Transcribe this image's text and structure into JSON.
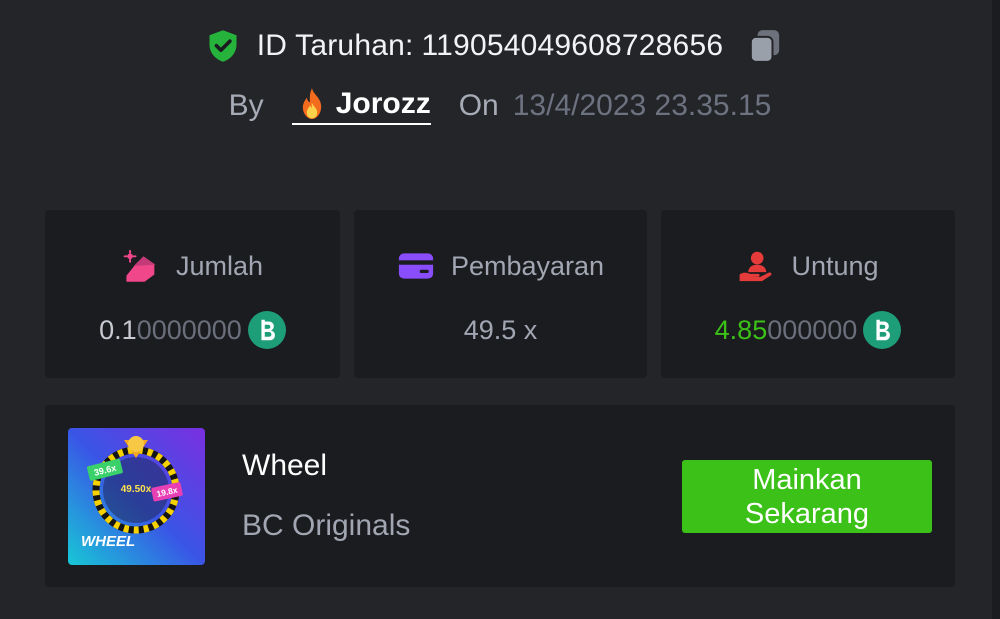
{
  "header": {
    "bet_id_label": "ID Taruhan:",
    "bet_id_value": "119054049608728656",
    "by_label": "By",
    "username": "Jorozz",
    "on_label": "On",
    "datetime": "13/4/2023 23.35.15"
  },
  "stats": {
    "amount": {
      "label": "Jumlah",
      "value_bright": "0.1",
      "value_dim": "0000000",
      "icon": "coins-hand-icon",
      "currency_icon": "bc-coin-icon"
    },
    "payout": {
      "label": "Pembayaran",
      "value": "49.5 x",
      "icon": "card-icon"
    },
    "profit": {
      "label": "Untung",
      "value_bright": "4.85",
      "value_dim": "000000",
      "icon": "hand-user-icon",
      "currency_icon": "bc-coin-icon"
    }
  },
  "game": {
    "name": "Wheel",
    "provider": "BC Originals",
    "play_button": "Mainkan Sekarang",
    "thumbnail": {
      "title": "WHEEL",
      "labels": [
        "39.6x",
        "49.50x",
        "19.8x"
      ]
    }
  },
  "colors": {
    "background": "#232528",
    "card": "#1b1c1f",
    "accent_green": "#3bc117",
    "coin": "#1e9e78",
    "shield": "#25b33c"
  }
}
